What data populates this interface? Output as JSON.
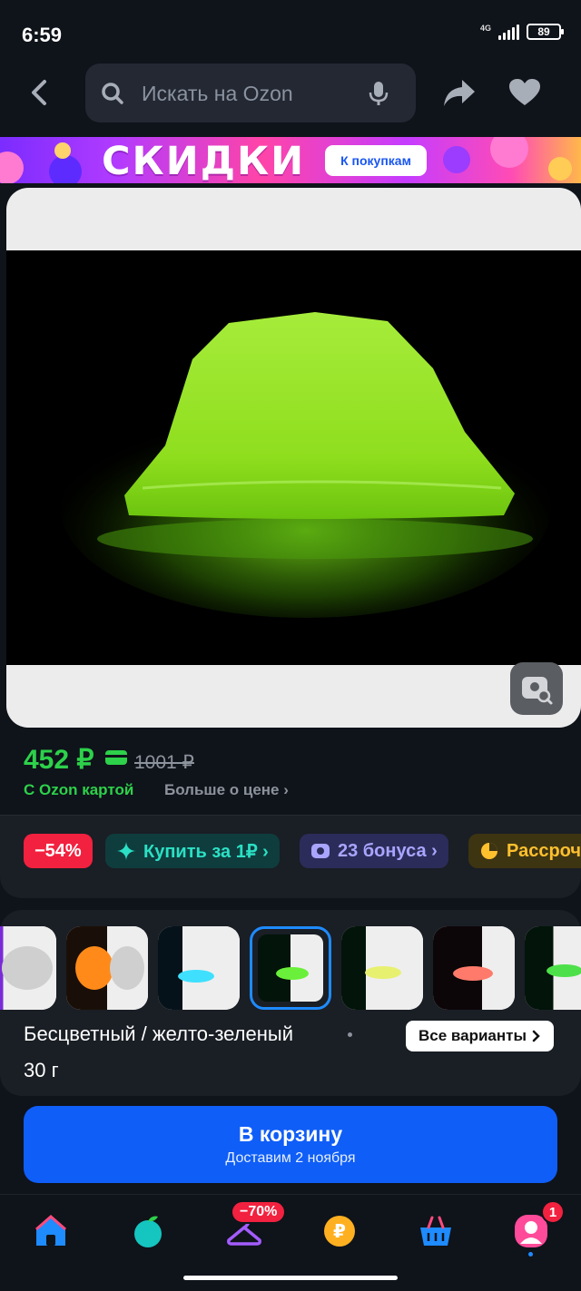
{
  "status": {
    "time": "6:59",
    "network": "4G",
    "battery": "89"
  },
  "search": {
    "placeholder": "Искать на Ozon"
  },
  "banner": {
    "title": "СКИДКИ",
    "button": "К покупкам"
  },
  "product": {
    "price": "452 ₽",
    "old_price": "1001 ₽",
    "ozon_card": "С Ozon картой",
    "more_about_price": "Больше о цене ›"
  },
  "chips": {
    "discount": "−54%",
    "buy_for_1": "Купить за 1₽ ›",
    "bonus": "23 бонуса ›",
    "installment": "Рассроч"
  },
  "variants": {
    "name": "Бесцветный / желто-зеленый",
    "weight": "30 г",
    "all_label": "Все варианты"
  },
  "cart": {
    "title": "В корзину",
    "subtitle": "Доставим 2 ноября"
  },
  "nav": {
    "sale_badge": "−70%",
    "profile_badge": "1"
  },
  "colors": {
    "accent_blue": "#0f5ef7",
    "price_green": "#2dd14a",
    "badge_red": "#f2213f"
  }
}
